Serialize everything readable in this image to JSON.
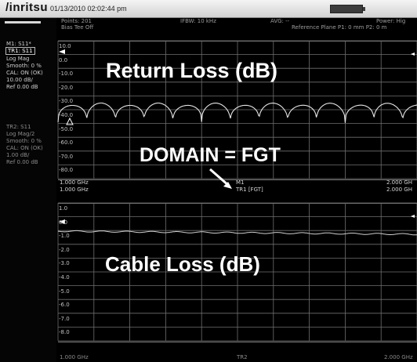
{
  "header": {
    "logo": "/inritsu",
    "datetime": "01/13/2010 02:02:44 pm"
  },
  "status": {
    "points": "Points: 201",
    "bias": "Bias Tee Off",
    "ifbw": "IFBW: 10 kHz",
    "avg": "AVG: --",
    "power": "Power: Hig",
    "ref_plane": "Reference Plane P1: 0 mm P2: 0 m"
  },
  "left_panel": {
    "tr1_lines": [
      "M1: S11*",
      "TR1: S11",
      "Log Mag",
      "Smooth: 0 %",
      "CAL: ON (OK)",
      "10.00 dB/",
      "Ref 0.00 dB"
    ],
    "tr2_lines": [
      "TR2: S11",
      "Log Mag/2",
      "Smooth: 0 %",
      "CAL: ON (OK)",
      "1.00 dB/",
      "Ref 0.00 dB"
    ]
  },
  "graph1": {
    "y_labels": [
      "10.0",
      "0.0",
      "-10.0",
      "-20.0",
      "-30.0",
      "-40.0",
      "-50.0",
      "-60.0",
      "-70.0",
      "-80.0"
    ],
    "start_freq": "1.000 GHz",
    "start_freq2": "1.000 GHz",
    "stop_freq": "2.000 GH",
    "stop_freq2": "2.000 GH",
    "marker_label": "M1",
    "trace_label": "TR1 [FGT]",
    "callout": "Return Loss (dB)"
  },
  "graph2": {
    "y_labels": [
      "1.0",
      "0.0",
      "-1.0",
      "-2.0",
      "-3.0",
      "-4.0",
      "-5.0",
      "-6.0",
      "-7.0",
      "-8.0"
    ],
    "start_freq": "1.000 GHz",
    "stop_freq": "2.000 GHz",
    "trace_label": "TR2",
    "callout": "Cable Loss (dB)"
  },
  "domain_callout": "DOMAIN = FGT",
  "colors": {
    "grid": "#6f6f6f",
    "trace": "#e6e6e6",
    "background": "#000000",
    "titlebar": "#e0e0e0"
  }
}
